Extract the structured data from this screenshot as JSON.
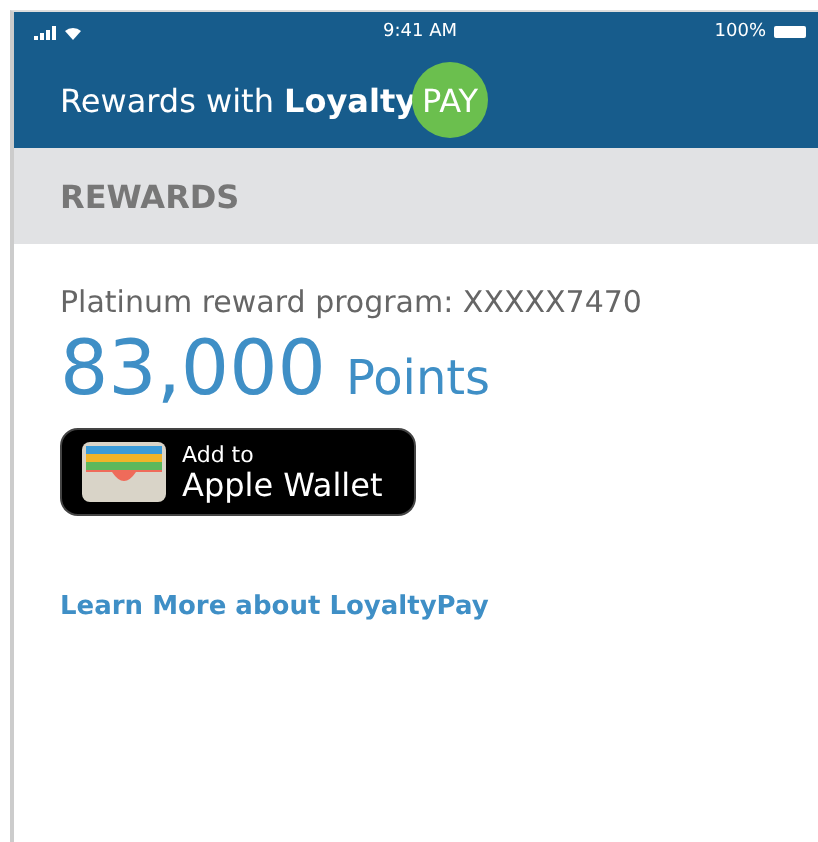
{
  "status_bar": {
    "time": "9:41 AM",
    "battery": "100%"
  },
  "header": {
    "title": "Rewards with **Loyalty**",
    "badge": "PAY"
  },
  "section": {
    "title": "REWARDS"
  },
  "program": {
    "label": "Platinum reward program: XXXXX7470",
    "points": "83,000",
    "unit": "Points"
  },
  "wallet_button": {
    "line_1": "Add to",
    "line_2": "Apple Wallet"
  },
  "link": "Learn More about LoyaltyPay"
}
